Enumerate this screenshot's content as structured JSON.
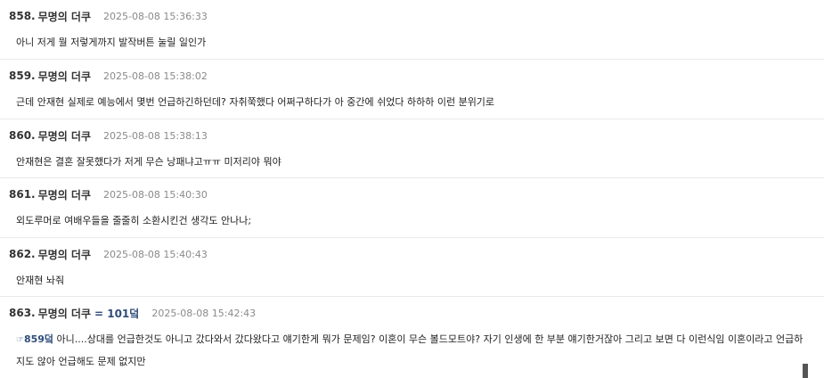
{
  "posts": [
    {
      "number": "858.",
      "author": "무명의 더쿠",
      "time": "2025-08-08 15:36:33",
      "body": "아니 저게 뭘 저렇게까지 발작버튼 눌릴 일인가"
    },
    {
      "number": "859.",
      "author": "무명의 더쿠",
      "time": "2025-08-08 15:38:02",
      "body": "근데 안재현 실제로 예능에서 몇번 언급하긴하던데? 자취쭉했다 어쩌구하다가 아 중간에 쉬었다 하하하 이런 분위기로"
    },
    {
      "number": "860.",
      "author": "무명의 더쿠",
      "time": "2025-08-08 15:38:13",
      "body": "안재현은 결혼 잘못했다가 저게 무슨 낭패냐고ㅠㅠ 미저리야 뭐야"
    },
    {
      "number": "861.",
      "author": "무명의 더쿠",
      "time": "2025-08-08 15:40:30",
      "body": "외도루머로 여배우들을 줄줄히 소환시킨건 생각도 안나나;"
    },
    {
      "number": "862.",
      "author": "무명의 더쿠",
      "time": "2025-08-08 15:40:43",
      "body": "안재현 놔줘"
    },
    {
      "number": "863.",
      "author": "무명의 더쿠",
      "score": "= 101덬",
      "time": "2025-08-08 15:42:43",
      "reply_icon": "☞",
      "reply_ref": "859덬",
      "body": " 아니....상대를 언급한것도 아니고 갔다와서 갔다왔다고 얘기한게 뭐가 문제임? 이혼이 무슨 볼드모트야? 자기 인생에 한 부분 얘기한거잖아 그리고 보면 다 이런식임 이혼이라고 언급하지도 않아 언급해도 문제 없지만"
    }
  ],
  "icons": {
    "reply": "pointing-hand-icon"
  },
  "colors": {
    "accent": "#2f4d7a",
    "timestamp": "#8a8a8a",
    "divider": "#e9e9e9"
  }
}
